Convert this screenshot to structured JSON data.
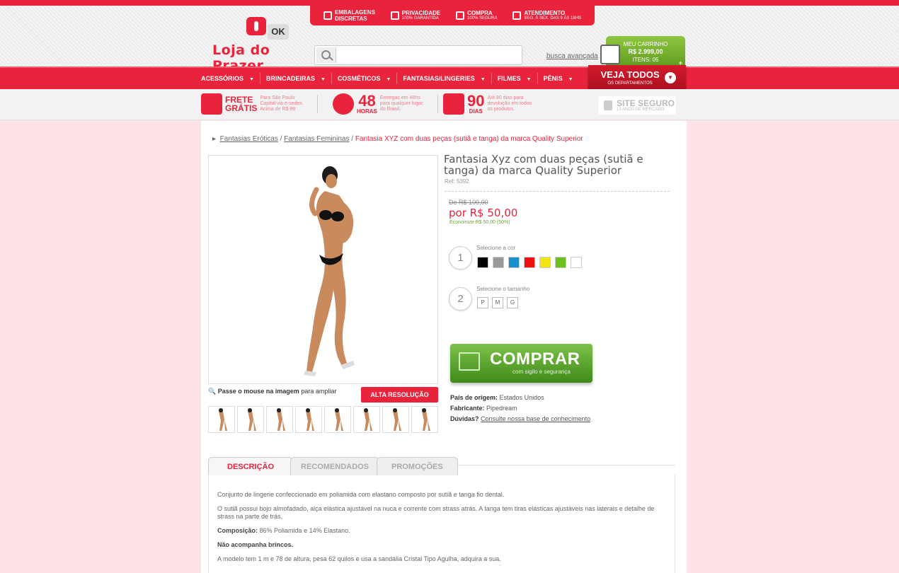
{
  "header": {
    "logo_ok": "OK",
    "logo_name": "Loja do Prazer",
    "trust": [
      {
        "title": "EMBALAGENS",
        "sub": "DISCRETAS",
        "icon": "box-icon"
      },
      {
        "title": "PRIVACIDADE",
        "sub": "100% GARANTIDA",
        "icon": "lock-icon"
      },
      {
        "title": "COMPRA",
        "sub": "100% SEGURA",
        "icon": "shield-icon"
      },
      {
        "title": "ATENDIMENTO",
        "sub": "SEG. À SEX. DAS 9 ÀS 18HS",
        "icon": "phone-icon"
      }
    ],
    "search_placeholder": "",
    "advanced_search": "busca avançada",
    "cart": {
      "label": "MEU CARRINHO",
      "total": "R$ 2.999,00",
      "items": "ITENS: 05",
      "plus": "+"
    }
  },
  "nav": {
    "items": [
      "ACESSÓRIOS",
      "BRINCADEIRAS",
      "COSMÉTICOS",
      "FANTASIAS/LINGERIES",
      "FILMES",
      "PÊNIS"
    ],
    "caret": "▼",
    "all_button": {
      "title": "VEJA TODOS",
      "sub": "OS DEPARTAMENTOS",
      "icon": "▼"
    }
  },
  "benefits": {
    "frete": {
      "big1": "FRETE",
      "big2": "GRÁTIS",
      "small": "Para São Paulo Capital via e-sedex. Acima de R$ 99"
    },
    "horas": {
      "num": "48",
      "unit": "HORAS",
      "small": "Entregas em 48hs para qualquer lugar do Brasil."
    },
    "dias": {
      "num": "90",
      "unit": "DIAS",
      "small": "Até 90 dias para devolução em todos os produtos."
    },
    "secure": {
      "title": "SITE SEGURO",
      "sub": "13 ANOS DE MERCADO"
    }
  },
  "breadcrumb": {
    "arrow": "▸",
    "items": [
      "Fantasias Eróticas",
      "Fantasias Femininas"
    ],
    "separator": "/",
    "current": "Fantasia XYZ com duas peças (sutiã e tanga) da marca Quality Superior"
  },
  "product": {
    "title": "Fantasia Xyz com duas peças (sutiã e tanga) da marca Quality Superior",
    "ref": "Ref: 5392",
    "old_price": "De R$ 100,00",
    "price": "por R$ 50,00",
    "economy": "Economize R$ 50,00 (50%)",
    "zoom_bold": "Passe o mouse na imagem",
    "zoom_rest": "para ampliar",
    "hires": "ALTA RESOLUÇÃO",
    "step1": {
      "num": "1",
      "label": "Selecione a cor"
    },
    "colors": [
      "#000000",
      "#999999",
      "#1a8fc9",
      "#ee1111",
      "#f2e412",
      "#6cbf1c",
      "#ffffff"
    ],
    "step2": {
      "num": "2",
      "label": "Selecione o tamanho"
    },
    "sizes": [
      "P",
      "M",
      "G"
    ],
    "buy": {
      "title": "COMPRAR",
      "sub": "com sigilo e segurança"
    },
    "origin_label": "País de origem:",
    "origin": "Estados Unidos",
    "maker_label": "Fabricante:",
    "maker": "Pipedream",
    "doubts_label": "Dúvidas?",
    "doubts_link": "Consulte nossa base de conhecimento"
  },
  "tabs": [
    "DESCRIÇÃO",
    "RECOMENDADOS",
    "PROMOÇÕES"
  ],
  "description": {
    "p1": "Conjunto de lingerie confeccionado em poliamida com elastano composto por sutiã e tanga fio dental.",
    "p2": "O sutiã possui bojo almofadado, alça elástica ajustável na nuca e corrente com strass atrás. A tanga tem tiras elásticas ajustáveis nas laterais e detalhe de strass na parte de trás.",
    "comp_label": "Composição:",
    "comp": "86% Poliamida e 14% Elastano.",
    "p4": "Não acompanha brincos.",
    "p5": "A modelo tem 1 m e 78 de altura, pesa 62 quilos e usa a sandália Cristal Tipo Agulha, adquira a sua."
  }
}
